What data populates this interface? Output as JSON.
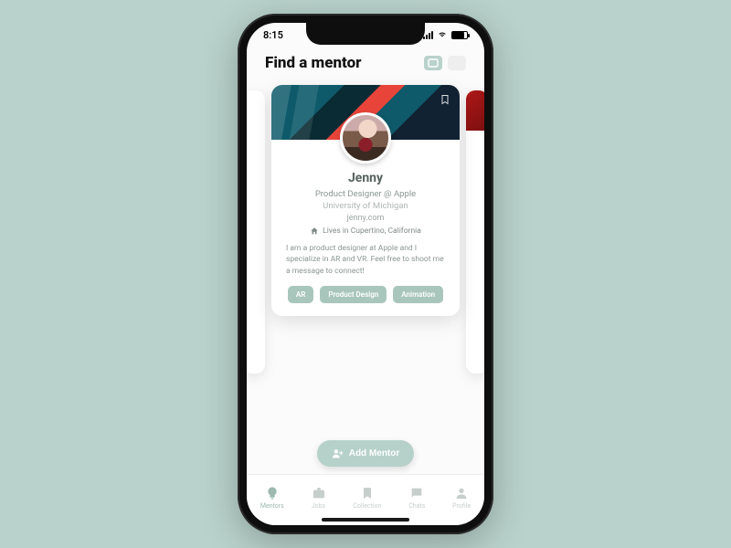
{
  "status": {
    "time": "8:15"
  },
  "header": {
    "title": "Find a mentor"
  },
  "mentor": {
    "name": "Jenny",
    "role": "Product Designer @ Apple",
    "university": "University of Michigan",
    "website": "jenny.com",
    "location": "Lives in Cupertino, California",
    "bio": "I am a product designer at Apple and I specialize in AR and VR. Feel free to shoot me a message to connect!",
    "tags": [
      "AR",
      "Product Design",
      "Animation"
    ]
  },
  "actions": {
    "add_mentor": "Add Mentor"
  },
  "tabs": {
    "mentors": "Mentors",
    "jobs": "Jobs",
    "collection": "Collection",
    "chats": "Chats",
    "profile": "Profile"
  }
}
